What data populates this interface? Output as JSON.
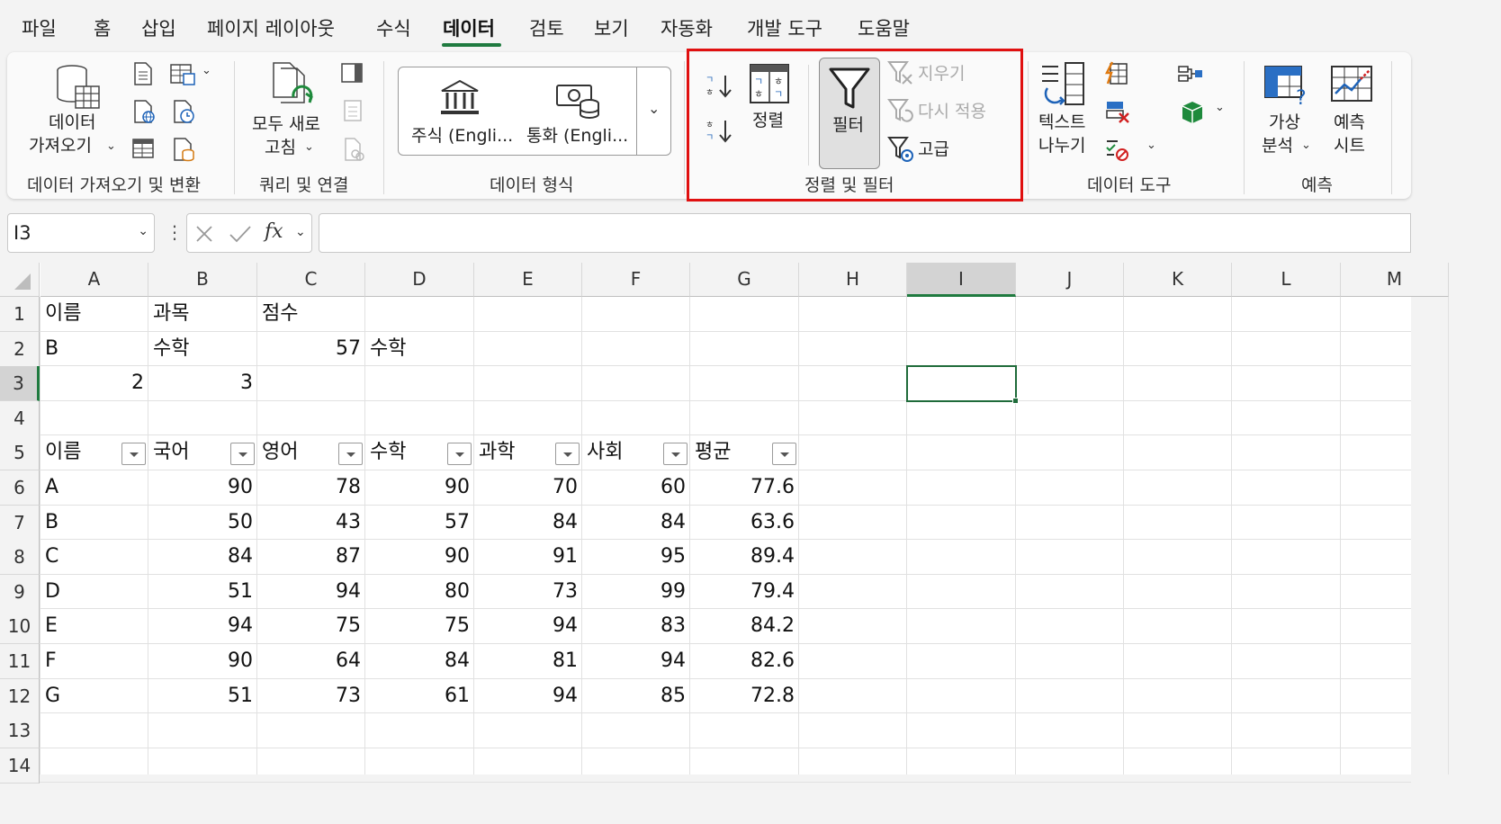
{
  "tabs": [
    {
      "label": "파일"
    },
    {
      "label": "홈"
    },
    {
      "label": "삽입"
    },
    {
      "label": "페이지 레이아웃"
    },
    {
      "label": "수식"
    },
    {
      "label": "데이터"
    },
    {
      "label": "검토"
    },
    {
      "label": "보기"
    },
    {
      "label": "자동화"
    },
    {
      "label": "개발 도구"
    },
    {
      "label": "도움말"
    }
  ],
  "active_tab": "데이터",
  "ribbon": {
    "get_transform": {
      "group_label": "데이터 가져오기 및 변환",
      "get_data_line1": "데이터",
      "get_data_line2": "가져오기"
    },
    "queries": {
      "group_label": "쿼리 및 연결",
      "refresh_line1": "모두 새로",
      "refresh_line2": "고침"
    },
    "data_types": {
      "group_label": "데이터 형식",
      "stocks": "주식 (Engli...",
      "currencies": "통화 (Engli..."
    },
    "sort_filter": {
      "group_label": "정렬 및 필터",
      "sort": "정렬",
      "filter": "필터",
      "clear": "지우기",
      "reapply": "다시 적용",
      "advanced": "고급"
    },
    "data_tools": {
      "group_label": "데이터 도구",
      "text_to_columns_line1": "텍스트",
      "text_to_columns_line2": "나누기"
    },
    "forecast": {
      "group_label": "예측",
      "what_if_line1": "가상",
      "what_if_line2": "분석",
      "forecast_sheet_line1": "예측",
      "forecast_sheet_line2": "시트"
    }
  },
  "formula_bar": {
    "name_box": "I3",
    "fx": "fx",
    "formula": ""
  },
  "colors": {
    "accent_green": "#1f7a3f",
    "highlight_red": "#e01010"
  },
  "grid": {
    "columns": [
      "A",
      "B",
      "C",
      "D",
      "E",
      "F",
      "G",
      "H",
      "I",
      "J",
      "K",
      "L",
      "M"
    ],
    "rows": [
      "1",
      "2",
      "3",
      "4",
      "5",
      "6",
      "7",
      "8",
      "9",
      "10",
      "11",
      "12",
      "13",
      "14"
    ],
    "selected_column": "I",
    "selected_row": "3",
    "cells": {
      "r1": [
        "이름",
        "과목",
        "점수"
      ],
      "r2": [
        "B",
        "수학",
        "57",
        "수학"
      ],
      "r3": [
        "2",
        "3"
      ],
      "header": [
        "이름",
        "국어",
        "영어",
        "수학",
        "과학",
        "사회",
        "평균"
      ],
      "data": [
        [
          "A",
          "90",
          "78",
          "90",
          "70",
          "60",
          "77.6"
        ],
        [
          "B",
          "50",
          "43",
          "57",
          "84",
          "84",
          "63.6"
        ],
        [
          "C",
          "84",
          "87",
          "90",
          "91",
          "95",
          "89.4"
        ],
        [
          "D",
          "51",
          "94",
          "80",
          "73",
          "99",
          "79.4"
        ],
        [
          "E",
          "94",
          "75",
          "75",
          "94",
          "83",
          "84.2"
        ],
        [
          "F",
          "90",
          "64",
          "84",
          "81",
          "94",
          "82.6"
        ],
        [
          "G",
          "51",
          "73",
          "61",
          "94",
          "85",
          "72.8"
        ]
      ]
    }
  }
}
